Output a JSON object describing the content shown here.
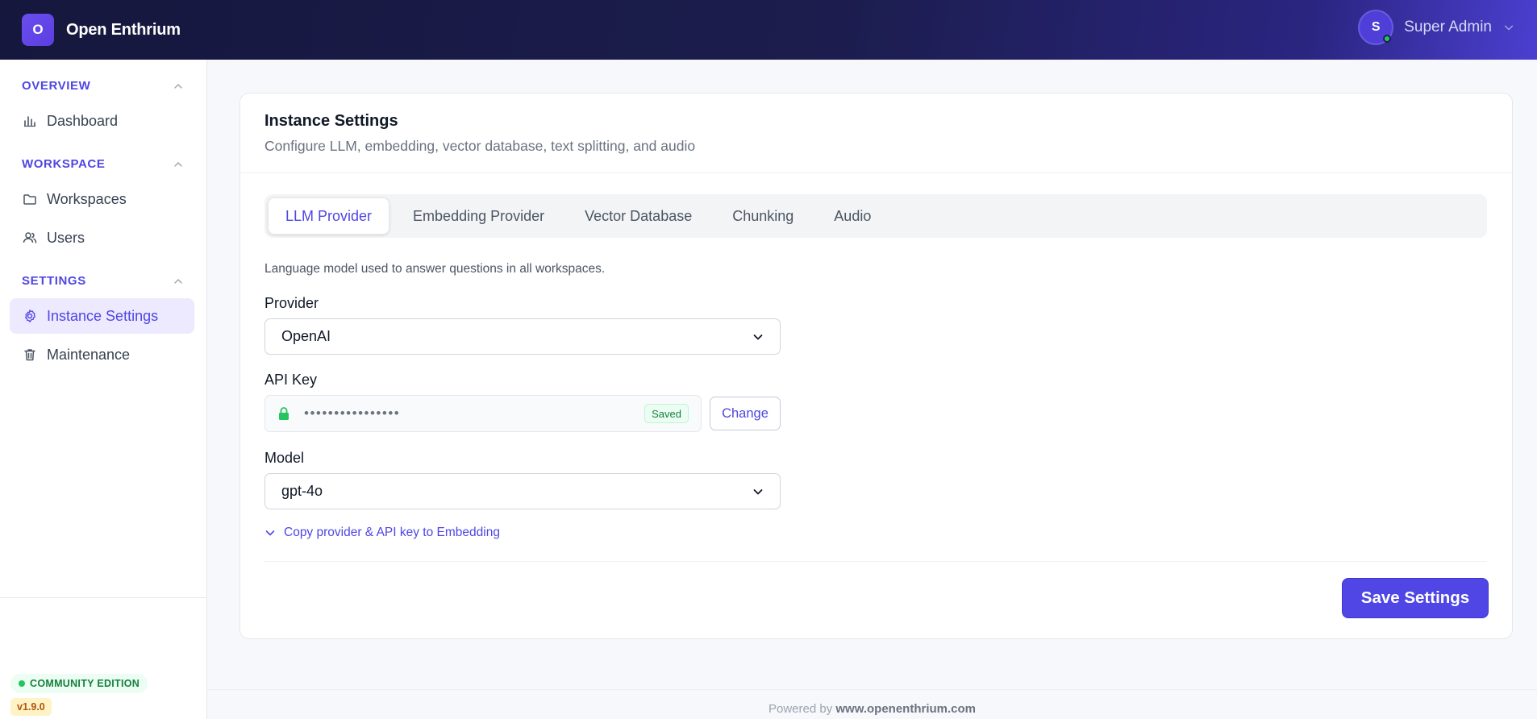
{
  "app": {
    "logo_letter": "O",
    "title": "Open Enthrium"
  },
  "user": {
    "avatar_letter": "S",
    "name": "Super Admin"
  },
  "sidebar": {
    "sections": [
      {
        "label": "OVERVIEW",
        "items": [
          {
            "label": "Dashboard",
            "icon": "bar-chart-icon"
          }
        ]
      },
      {
        "label": "WORKSPACE",
        "items": [
          {
            "label": "Workspaces",
            "icon": "folder-icon"
          },
          {
            "label": "Users",
            "icon": "users-icon"
          }
        ]
      },
      {
        "label": "SETTINGS",
        "items": [
          {
            "label": "Instance Settings",
            "icon": "gear-icon",
            "active": true
          },
          {
            "label": "Maintenance",
            "icon": "trash-icon"
          }
        ]
      }
    ],
    "edition": "COMMUNITY EDITION",
    "version": "v1.9.0"
  },
  "card": {
    "title": "Instance Settings",
    "subtitle": "Configure LLM, embedding, vector database, text splitting, and audio",
    "tabs": [
      {
        "label": "LLM Provider",
        "active": true
      },
      {
        "label": "Embedding Provider"
      },
      {
        "label": "Vector Database"
      },
      {
        "label": "Chunking"
      },
      {
        "label": "Audio"
      }
    ],
    "hint": "Language model used to answer questions in all workspaces.",
    "provider": {
      "label": "Provider",
      "value": "OpenAI"
    },
    "api_key": {
      "label": "API Key",
      "mask": "••••••••••••••••",
      "status": "Saved",
      "change_label": "Change"
    },
    "model": {
      "label": "Model",
      "value": "gpt-4o"
    },
    "copy_link": "Copy provider & API key to Embedding",
    "save_label": "Save Settings"
  },
  "footer": {
    "prefix": "Powered by",
    "link": "www.openenthrium.com"
  },
  "colors": {
    "accent": "#4f46e5",
    "header_dark": "#15173d",
    "success": "#22c55e"
  }
}
